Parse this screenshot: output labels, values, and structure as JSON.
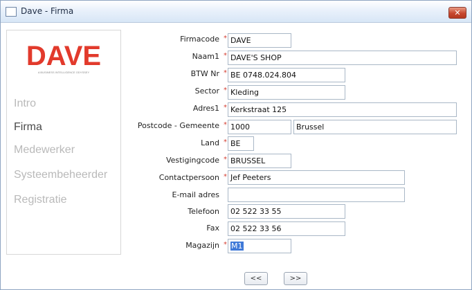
{
  "window": {
    "title": "Dave - Firma",
    "close_label": "✕"
  },
  "logo": {
    "text": "DAVE",
    "tagline": "A BUSINESS INTELLIGENCE ODYSSEY",
    "color": "#e23a2c"
  },
  "nav": [
    {
      "label": "Intro",
      "active": false
    },
    {
      "label": "Firma",
      "active": true
    },
    {
      "label": "Medewerker",
      "active": false
    },
    {
      "label": "Systeembeheerder",
      "active": false
    },
    {
      "label": "Registratie",
      "active": false
    }
  ],
  "form": {
    "firmacode": {
      "label": "Firmacode",
      "value": "DAVE",
      "required": true
    },
    "naam1": {
      "label": "Naam1",
      "value": "DAVE'S SHOP",
      "required": true
    },
    "btw": {
      "label": "BTW Nr",
      "value": "BE 0748.024.804",
      "required": true
    },
    "sector": {
      "label": "Sector",
      "value": "Kleding",
      "required": true
    },
    "adres1": {
      "label": "Adres1",
      "value": "Kerkstraat 125",
      "required": true
    },
    "postcode": {
      "label": "Postcode - Gemeente",
      "value": "1000",
      "required": true
    },
    "gemeente": {
      "value": "Brussel"
    },
    "land": {
      "label": "Land",
      "value": "BE",
      "required": true
    },
    "vestigingcode": {
      "label": "Vestigingcode",
      "value": "BRUSSEL",
      "required": true
    },
    "contactpersoon": {
      "label": "Contactpersoon",
      "value": "Jef Peeters",
      "required": true
    },
    "email": {
      "label": "E-mail adres",
      "value": "",
      "required": false
    },
    "telefoon": {
      "label": "Telefoon",
      "value": "02 522 33 55",
      "required": false
    },
    "fax": {
      "label": "Fax",
      "value": "02 522 33 56",
      "required": false
    },
    "magazijn": {
      "label": "Magazijn",
      "value": "M1",
      "required": true
    }
  },
  "buttons": {
    "prev": "<<",
    "next": ">>"
  },
  "required_mark": "*"
}
